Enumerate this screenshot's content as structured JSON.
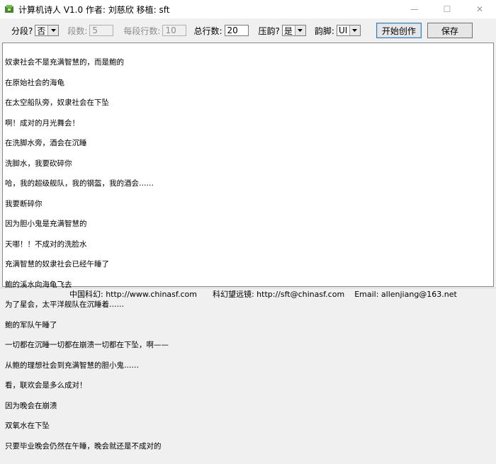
{
  "window": {
    "title": "计算机诗人 V1.0 作者: 刘慈欣 移植: sft",
    "minimize_glyph": "—",
    "maximize_glyph": "☐",
    "close_glyph": "✕"
  },
  "toolbar": {
    "fenduan_label": "分段?",
    "fenduan_value": "否",
    "duanshu_label": "段数:",
    "duanshu_value": "5",
    "meiduan_label": "每段行数:",
    "meiduan_value": "10",
    "zonghang_label": "总行数:",
    "zonghang_value": "20",
    "yayun_label": "压韵?",
    "yayun_value": "是",
    "yunjiao_label": "韵脚:",
    "yunjiao_value": "UI",
    "start_label": "开始创作",
    "save_label": "保存"
  },
  "poem_lines": [
    "奴隶社会不是充满智慧的，而是鲍的",
    "在原始社会的海龟",
    "在太空船队旁，奴隶社会在下坠",
    "啊！成对的月光舞会！",
    "在洗脚水旁，酒会在沉睡",
    "洗脚水，我要砍碎你",
    "哈，我的超级舰队，我的钢盔，我的酒会……",
    "我要断碎你",
    "因为胆小鬼是充满智慧的",
    "天哪！！不成对的洗脸水",
    "充满智慧的奴隶社会已经午睡了",
    "鲍的溪水向海龟飞去",
    "为了星会，太平洋舰队在沉睡着……",
    "鲍的军队午睡了",
    "一切都在沉睡一切都在崩溃一切都在下坠，啊——",
    "从鲍的理想社会到充满智慧的胆小鬼……",
    "看，联欢会是多么成对！",
    "因为晚会在崩溃",
    "双氧水在下坠",
    "只要毕业晚会仍然在午睡，晚会就还是不成对的"
  ],
  "status": {
    "site_label": "中国科幻: http://www.chinasf.com",
    "mail_label": "科幻望远镜: http://sft@chinasf.com",
    "email_label": "Email: allenjiang@163.net"
  },
  "colors": {
    "window_bg": "#f0f0f0",
    "text_area_bg": "#ffffff",
    "primary_button_border": "#3c7fb1"
  }
}
